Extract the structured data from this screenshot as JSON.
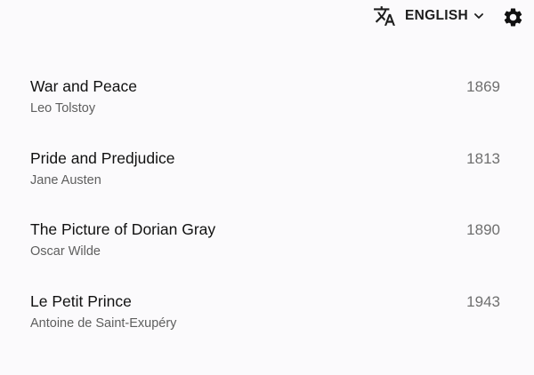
{
  "header": {
    "language_label": "ENGLISH",
    "icons": {
      "translate": "translate-icon",
      "dropdown": "chevron-down-icon",
      "settings": "gear-icon"
    }
  },
  "books": [
    {
      "title": "War and Peace",
      "author": "Leo Tolstoy",
      "year": "1869"
    },
    {
      "title": "Pride and Predjudice",
      "author": "Jane Austen",
      "year": "1813"
    },
    {
      "title": "The Picture of Dorian Gray",
      "author": "Oscar Wilde",
      "year": "1890"
    },
    {
      "title": "Le Petit Prince",
      "author": "Antoine de Saint-Exupéry",
      "year": "1943"
    }
  ],
  "colors": {
    "background": "#fbfafc",
    "title_text": "#111111",
    "secondary_text": "#5e5e5e",
    "year_text": "#6f6f6f"
  }
}
